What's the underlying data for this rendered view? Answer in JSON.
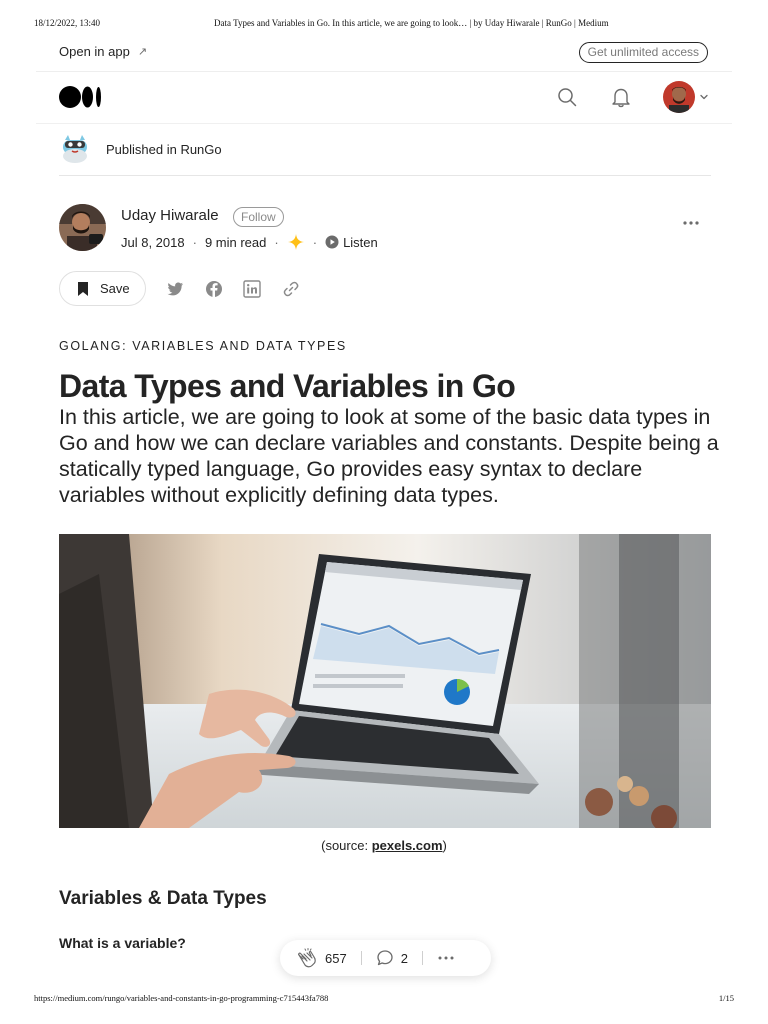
{
  "print_header": {
    "date": "18/12/2022, 13:40",
    "title": "Data Types and Variables in Go. In this article, we are going to look… | by Uday Hiwarale | RunGo | Medium"
  },
  "topbar": {
    "open_in_app": "Open in app",
    "get_unlimited_access": "Get unlimited access"
  },
  "navbar": {
    "logo_icon": "medium-logo-icon",
    "search_icon": "search-icon",
    "notifications_icon": "bell-icon"
  },
  "publication": {
    "published_in": "Published in RunGo"
  },
  "author": {
    "name": "Uday Hiwarale",
    "follow_label": "Follow",
    "date": "Jul 8, 2018",
    "read_time": "9 min read",
    "listen_label": "Listen",
    "star_color": "#FFC017"
  },
  "actions": {
    "save_label": "Save"
  },
  "article": {
    "kicker": "GOLANG: VARIABLES AND DATA TYPES",
    "title": "Data Types and Variables in Go",
    "subtitle": "In this article, we are going to look at some of the basic data types in Go and how we can declare variables and constants. Despite being a statically typed language, Go provides easy syntax to declare variables without explicitly defining data types.",
    "caption_prefix": "(source: ",
    "caption_link": "pexels.com",
    "caption_suffix": ")",
    "section_heading": "Variables & Data Types",
    "sub_heading": "What is a variable?"
  },
  "floating_bar": {
    "claps": "657",
    "responses": "2"
  },
  "print_footer": {
    "url": "https://medium.com/rungo/variables-and-constants-in-go-programming-c715443fa788",
    "page": "1/15"
  }
}
